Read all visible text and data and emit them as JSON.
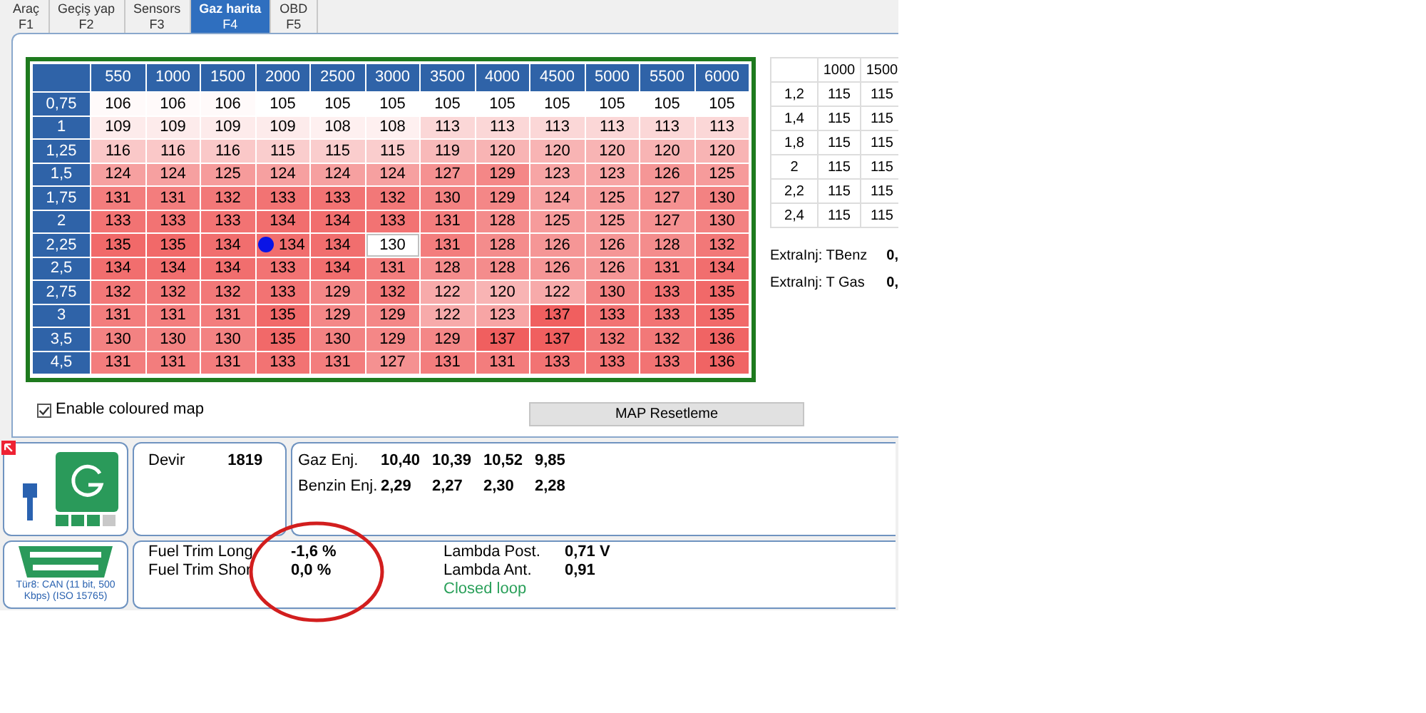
{
  "tabs": [
    {
      "label": "Araç",
      "key": "F1",
      "selected": false
    },
    {
      "label": "Geçiş yap",
      "key": "F2",
      "selected": false
    },
    {
      "label": "Sensors",
      "key": "F3",
      "selected": false
    },
    {
      "label": "Gaz harita",
      "key": "F4",
      "selected": true
    },
    {
      "label": "OBD",
      "key": "F5",
      "selected": false
    }
  ],
  "map": {
    "coloured": true,
    "columns": [
      "550",
      "1000",
      "1500",
      "2000",
      "2500",
      "3000",
      "3500",
      "4000",
      "4500",
      "5000",
      "5500",
      "6000"
    ],
    "rows": [
      {
        "label": "0,75",
        "cells": [
          {
            "value": "106",
            "selected": false,
            "marker": false
          },
          {
            "value": "106",
            "selected": false,
            "marker": false
          },
          {
            "value": "106",
            "selected": false,
            "marker": false
          },
          {
            "value": "105",
            "selected": false,
            "marker": false
          },
          {
            "value": "105",
            "selected": false,
            "marker": false
          },
          {
            "value": "105",
            "selected": false,
            "marker": false
          },
          {
            "value": "105",
            "selected": false,
            "marker": false
          },
          {
            "value": "105",
            "selected": false,
            "marker": false
          },
          {
            "value": "105",
            "selected": false,
            "marker": false
          },
          {
            "value": "105",
            "selected": false,
            "marker": false
          },
          {
            "value": "105",
            "selected": false,
            "marker": false
          },
          {
            "value": "105",
            "selected": false,
            "marker": false
          }
        ]
      },
      {
        "label": "1",
        "cells": [
          {
            "value": "109",
            "selected": false,
            "marker": false
          },
          {
            "value": "109",
            "selected": false,
            "marker": false
          },
          {
            "value": "109",
            "selected": false,
            "marker": false
          },
          {
            "value": "109",
            "selected": false,
            "marker": false
          },
          {
            "value": "108",
            "selected": false,
            "marker": false
          },
          {
            "value": "108",
            "selected": false,
            "marker": false
          },
          {
            "value": "113",
            "selected": false,
            "marker": false
          },
          {
            "value": "113",
            "selected": false,
            "marker": false
          },
          {
            "value": "113",
            "selected": false,
            "marker": false
          },
          {
            "value": "113",
            "selected": false,
            "marker": false
          },
          {
            "value": "113",
            "selected": false,
            "marker": false
          },
          {
            "value": "113",
            "selected": false,
            "marker": false
          }
        ]
      },
      {
        "label": "1,25",
        "cells": [
          {
            "value": "116",
            "selected": false,
            "marker": false
          },
          {
            "value": "116",
            "selected": false,
            "marker": false
          },
          {
            "value": "116",
            "selected": false,
            "marker": false
          },
          {
            "value": "115",
            "selected": false,
            "marker": false
          },
          {
            "value": "115",
            "selected": false,
            "marker": false
          },
          {
            "value": "115",
            "selected": false,
            "marker": false
          },
          {
            "value": "119",
            "selected": false,
            "marker": false
          },
          {
            "value": "120",
            "selected": false,
            "marker": false
          },
          {
            "value": "120",
            "selected": false,
            "marker": false
          },
          {
            "value": "120",
            "selected": false,
            "marker": false
          },
          {
            "value": "120",
            "selected": false,
            "marker": false
          },
          {
            "value": "120",
            "selected": false,
            "marker": false
          }
        ]
      },
      {
        "label": "1,5",
        "cells": [
          {
            "value": "124",
            "selected": false,
            "marker": false
          },
          {
            "value": "124",
            "selected": false,
            "marker": false
          },
          {
            "value": "125",
            "selected": false,
            "marker": false
          },
          {
            "value": "124",
            "selected": false,
            "marker": false
          },
          {
            "value": "124",
            "selected": false,
            "marker": false
          },
          {
            "value": "124",
            "selected": false,
            "marker": false
          },
          {
            "value": "127",
            "selected": false,
            "marker": false
          },
          {
            "value": "129",
            "selected": false,
            "marker": false
          },
          {
            "value": "123",
            "selected": false,
            "marker": false
          },
          {
            "value": "123",
            "selected": false,
            "marker": false
          },
          {
            "value": "126",
            "selected": false,
            "marker": false
          },
          {
            "value": "125",
            "selected": false,
            "marker": false
          }
        ]
      },
      {
        "label": "1,75",
        "cells": [
          {
            "value": "131",
            "selected": false,
            "marker": false
          },
          {
            "value": "131",
            "selected": false,
            "marker": false
          },
          {
            "value": "132",
            "selected": false,
            "marker": false
          },
          {
            "value": "133",
            "selected": false,
            "marker": false
          },
          {
            "value": "133",
            "selected": false,
            "marker": false
          },
          {
            "value": "132",
            "selected": false,
            "marker": false
          },
          {
            "value": "130",
            "selected": false,
            "marker": false
          },
          {
            "value": "129",
            "selected": false,
            "marker": false
          },
          {
            "value": "124",
            "selected": false,
            "marker": false
          },
          {
            "value": "125",
            "selected": false,
            "marker": false
          },
          {
            "value": "127",
            "selected": false,
            "marker": false
          },
          {
            "value": "130",
            "selected": false,
            "marker": false
          }
        ]
      },
      {
        "label": "2",
        "cells": [
          {
            "value": "133",
            "selected": false,
            "marker": false
          },
          {
            "value": "133",
            "selected": false,
            "marker": false
          },
          {
            "value": "133",
            "selected": false,
            "marker": false
          },
          {
            "value": "134",
            "selected": false,
            "marker": false
          },
          {
            "value": "134",
            "selected": false,
            "marker": false
          },
          {
            "value": "133",
            "selected": false,
            "marker": false
          },
          {
            "value": "131",
            "selected": false,
            "marker": false
          },
          {
            "value": "128",
            "selected": false,
            "marker": false
          },
          {
            "value": "125",
            "selected": false,
            "marker": false
          },
          {
            "value": "125",
            "selected": false,
            "marker": false
          },
          {
            "value": "127",
            "selected": false,
            "marker": false
          },
          {
            "value": "130",
            "selected": false,
            "marker": false
          }
        ]
      },
      {
        "label": "2,25",
        "cells": [
          {
            "value": "135",
            "selected": false,
            "marker": false
          },
          {
            "value": "135",
            "selected": false,
            "marker": false
          },
          {
            "value": "134",
            "selected": false,
            "marker": false
          },
          {
            "value": "134",
            "selected": false,
            "marker": true
          },
          {
            "value": "134",
            "selected": false,
            "marker": false
          },
          {
            "value": "130",
            "selected": true,
            "marker": false
          },
          {
            "value": "131",
            "selected": false,
            "marker": false
          },
          {
            "value": "128",
            "selected": false,
            "marker": false
          },
          {
            "value": "126",
            "selected": false,
            "marker": false
          },
          {
            "value": "126",
            "selected": false,
            "marker": false
          },
          {
            "value": "128",
            "selected": false,
            "marker": false
          },
          {
            "value": "132",
            "selected": false,
            "marker": false
          }
        ]
      },
      {
        "label": "2,5",
        "cells": [
          {
            "value": "134",
            "selected": false,
            "marker": false
          },
          {
            "value": "134",
            "selected": false,
            "marker": false
          },
          {
            "value": "134",
            "selected": false,
            "marker": false
          },
          {
            "value": "133",
            "selected": false,
            "marker": false
          },
          {
            "value": "134",
            "selected": false,
            "marker": false
          },
          {
            "value": "131",
            "selected": false,
            "marker": false
          },
          {
            "value": "128",
            "selected": false,
            "marker": false
          },
          {
            "value": "128",
            "selected": false,
            "marker": false
          },
          {
            "value": "126",
            "selected": false,
            "marker": false
          },
          {
            "value": "126",
            "selected": false,
            "marker": false
          },
          {
            "value": "131",
            "selected": false,
            "marker": false
          },
          {
            "value": "134",
            "selected": false,
            "marker": false
          }
        ]
      },
      {
        "label": "2,75",
        "cells": [
          {
            "value": "132",
            "selected": false,
            "marker": false
          },
          {
            "value": "132",
            "selected": false,
            "marker": false
          },
          {
            "value": "132",
            "selected": false,
            "marker": false
          },
          {
            "value": "133",
            "selected": false,
            "marker": false
          },
          {
            "value": "129",
            "selected": false,
            "marker": false
          },
          {
            "value": "132",
            "selected": false,
            "marker": false
          },
          {
            "value": "122",
            "selected": false,
            "marker": false
          },
          {
            "value": "120",
            "selected": false,
            "marker": false
          },
          {
            "value": "122",
            "selected": false,
            "marker": false
          },
          {
            "value": "130",
            "selected": false,
            "marker": false
          },
          {
            "value": "133",
            "selected": false,
            "marker": false
          },
          {
            "value": "135",
            "selected": false,
            "marker": false
          }
        ]
      },
      {
        "label": "3",
        "cells": [
          {
            "value": "131",
            "selected": false,
            "marker": false
          },
          {
            "value": "131",
            "selected": false,
            "marker": false
          },
          {
            "value": "131",
            "selected": false,
            "marker": false
          },
          {
            "value": "135",
            "selected": false,
            "marker": false
          },
          {
            "value": "129",
            "selected": false,
            "marker": false
          },
          {
            "value": "129",
            "selected": false,
            "marker": false
          },
          {
            "value": "122",
            "selected": false,
            "marker": false
          },
          {
            "value": "123",
            "selected": false,
            "marker": false
          },
          {
            "value": "137",
            "selected": false,
            "marker": false
          },
          {
            "value": "133",
            "selected": false,
            "marker": false
          },
          {
            "value": "133",
            "selected": false,
            "marker": false
          },
          {
            "value": "135",
            "selected": false,
            "marker": false
          }
        ]
      },
      {
        "label": "3,5",
        "cells": [
          {
            "value": "130",
            "selected": false,
            "marker": false
          },
          {
            "value": "130",
            "selected": false,
            "marker": false
          },
          {
            "value": "130",
            "selected": false,
            "marker": false
          },
          {
            "value": "135",
            "selected": false,
            "marker": false
          },
          {
            "value": "130",
            "selected": false,
            "marker": false
          },
          {
            "value": "129",
            "selected": false,
            "marker": false
          },
          {
            "value": "129",
            "selected": false,
            "marker": false
          },
          {
            "value": "137",
            "selected": false,
            "marker": false
          },
          {
            "value": "137",
            "selected": false,
            "marker": false
          },
          {
            "value": "132",
            "selected": false,
            "marker": false
          },
          {
            "value": "132",
            "selected": false,
            "marker": false
          },
          {
            "value": "136",
            "selected": false,
            "marker": false
          }
        ]
      },
      {
        "label": "4,5",
        "cells": [
          {
            "value": "131",
            "selected": false,
            "marker": false
          },
          {
            "value": "131",
            "selected": false,
            "marker": false
          },
          {
            "value": "131",
            "selected": false,
            "marker": false
          },
          {
            "value": "133",
            "selected": false,
            "marker": false
          },
          {
            "value": "131",
            "selected": false,
            "marker": false
          },
          {
            "value": "127",
            "selected": false,
            "marker": false
          },
          {
            "value": "131",
            "selected": false,
            "marker": false
          },
          {
            "value": "131",
            "selected": false,
            "marker": false
          },
          {
            "value": "133",
            "selected": false,
            "marker": false
          },
          {
            "value": "133",
            "selected": false,
            "marker": false
          },
          {
            "value": "133",
            "selected": false,
            "marker": false
          },
          {
            "value": "136",
            "selected": false,
            "marker": false
          }
        ]
      }
    ]
  },
  "side_table": {
    "columns": [
      "1000",
      "1500"
    ],
    "rows": [
      {
        "label": "1,2",
        "cells": [
          "115",
          "115"
        ]
      },
      {
        "label": "1,4",
        "cells": [
          "115",
          "115"
        ]
      },
      {
        "label": "1,8",
        "cells": [
          "115",
          "115"
        ]
      },
      {
        "label": "2",
        "cells": [
          "115",
          "115"
        ]
      },
      {
        "label": "2,2",
        "cells": [
          "115",
          "115"
        ]
      },
      {
        "label": "2,4",
        "cells": [
          "115",
          "115"
        ]
      }
    ]
  },
  "extra_inj": [
    {
      "label": "ExtraInj: TBenz",
      "value": "0,"
    },
    {
      "label": "ExtraInj: T Gas",
      "value": "0,"
    }
  ],
  "enable_coloured_map": {
    "label": "Enable coloured map",
    "checked": true
  },
  "reset_button": "MAP Resetleme",
  "devir": {
    "label": "Devir",
    "value": "1819"
  },
  "injectors": [
    {
      "label": "Gaz Enj.",
      "values": [
        "10,40",
        "10,39",
        "10,52",
        "9,85"
      ]
    },
    {
      "label": "Benzin Enj.",
      "values": [
        "2,29",
        "2,27",
        "2,30",
        "2,28"
      ]
    }
  ],
  "obd_protocol": "Tür8: CAN (11 bit, 500 Kbps) (ISO 15765)",
  "fuel_trims": [
    {
      "label": "Fuel Trim Long",
      "value": "-1,6 %"
    },
    {
      "label": "Fuel Trim Shor",
      "value": "0,0 %"
    }
  ],
  "lambda": [
    {
      "label": "Lambda Post.",
      "value": "0,71 V"
    },
    {
      "label": "Lambda Ant.",
      "value": "0,91"
    }
  ],
  "loop_status": "Closed loop"
}
